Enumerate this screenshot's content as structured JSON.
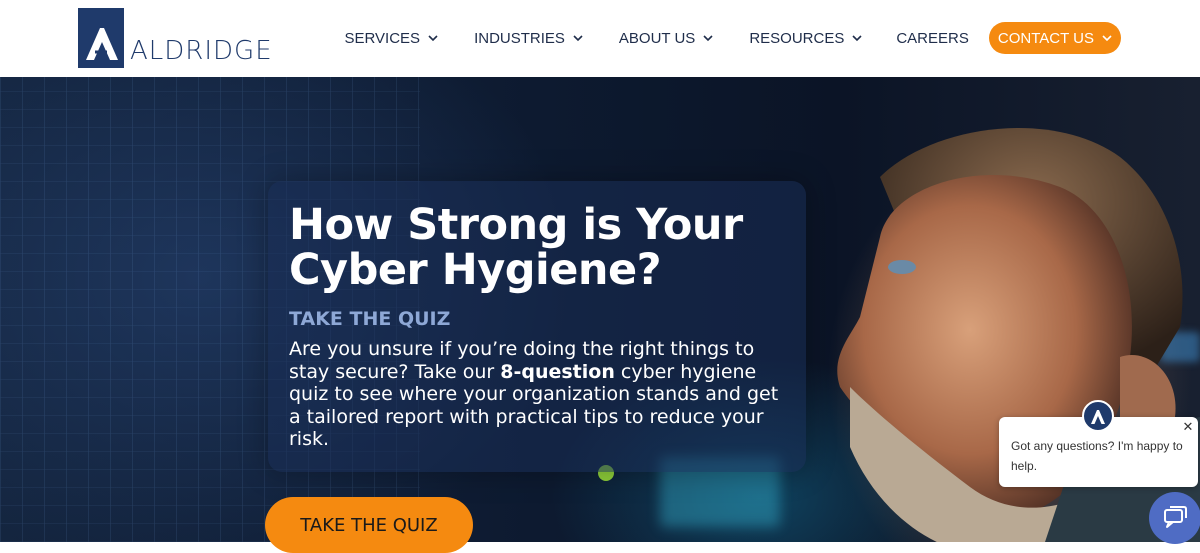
{
  "brand": {
    "name": "ALDRIDGE",
    "logo_color": "#1f3a6b"
  },
  "nav": {
    "items": [
      {
        "label": "SERVICES",
        "has_dropdown": true
      },
      {
        "label": "INDUSTRIES",
        "has_dropdown": true
      },
      {
        "label": "ABOUT US",
        "has_dropdown": true
      },
      {
        "label": "RESOURCES",
        "has_dropdown": true
      },
      {
        "label": "CAREERS",
        "has_dropdown": false
      }
    ],
    "contact": {
      "label": "CONTACT US",
      "has_dropdown": true,
      "color": "#f58a10"
    }
  },
  "hero": {
    "title": "How Strong is Your Cyber Hygiene?",
    "subtitle": "TAKE THE QUIZ",
    "body_before": "Are you unsure if you’re doing the right things to stay secure? Take our ",
    "body_bold": "8-question",
    "body_after": " cyber hygiene quiz to see where your organization stands and get a tailored report with practical tips to reduce your risk.",
    "cta_label": "TAKE THE QUIZ",
    "cta_color": "#f58a10"
  },
  "chat": {
    "message": "Got any questions? I'm happy to help.",
    "close_icon": "close-icon",
    "launcher_icon": "chat-icon",
    "launcher_color": "#4f6cc4"
  }
}
